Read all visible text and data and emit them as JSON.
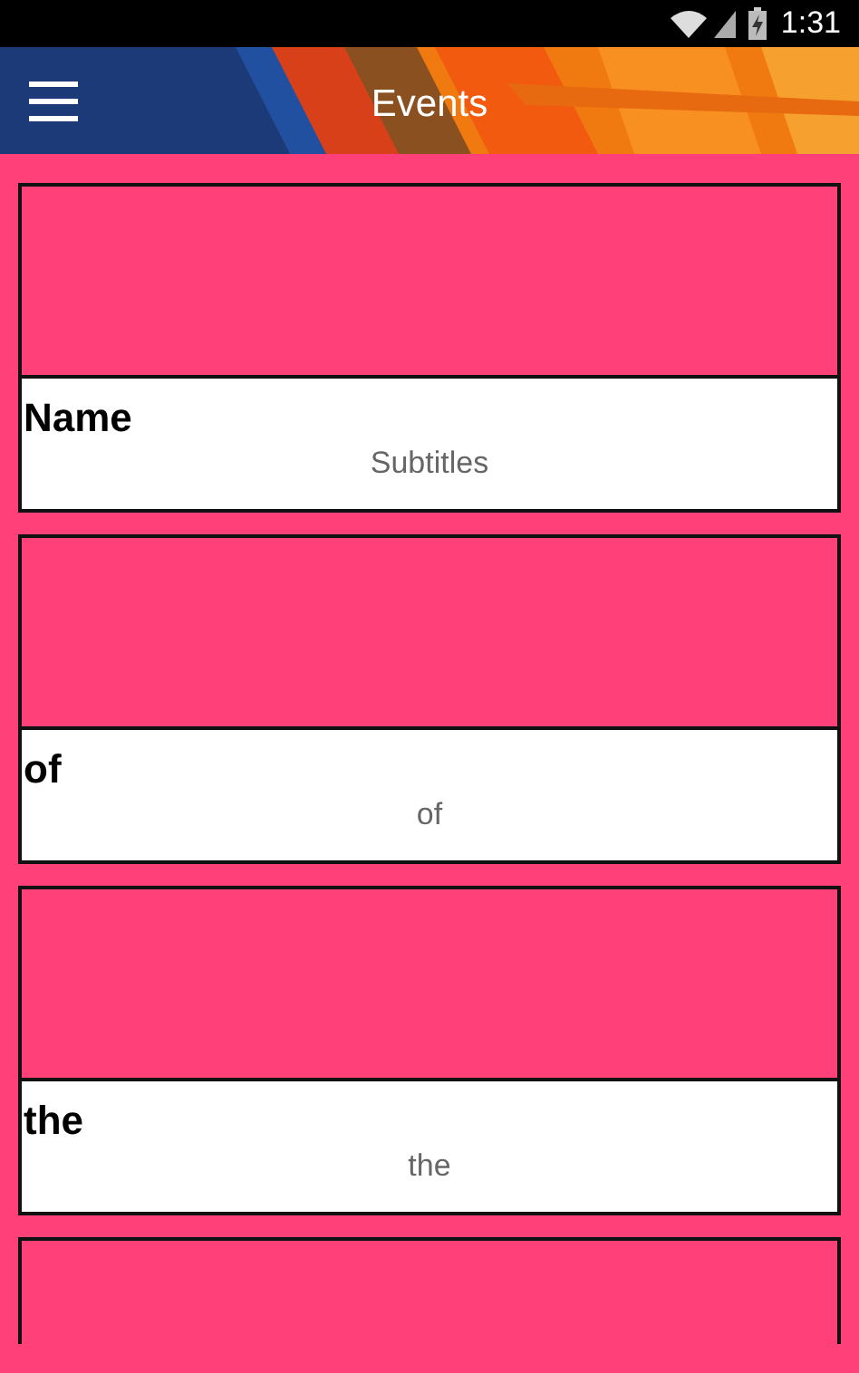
{
  "status_bar": {
    "time": "1:31"
  },
  "app_bar": {
    "title": "Events"
  },
  "cards": [
    {
      "kind": "event",
      "name": "Name",
      "subtitle": "Subtitles"
    },
    {
      "kind": "event",
      "name": "of",
      "subtitle": "of"
    },
    {
      "kind": "event",
      "name": "the",
      "subtitle": "the"
    },
    {
      "kind": "cut_off"
    }
  ]
}
